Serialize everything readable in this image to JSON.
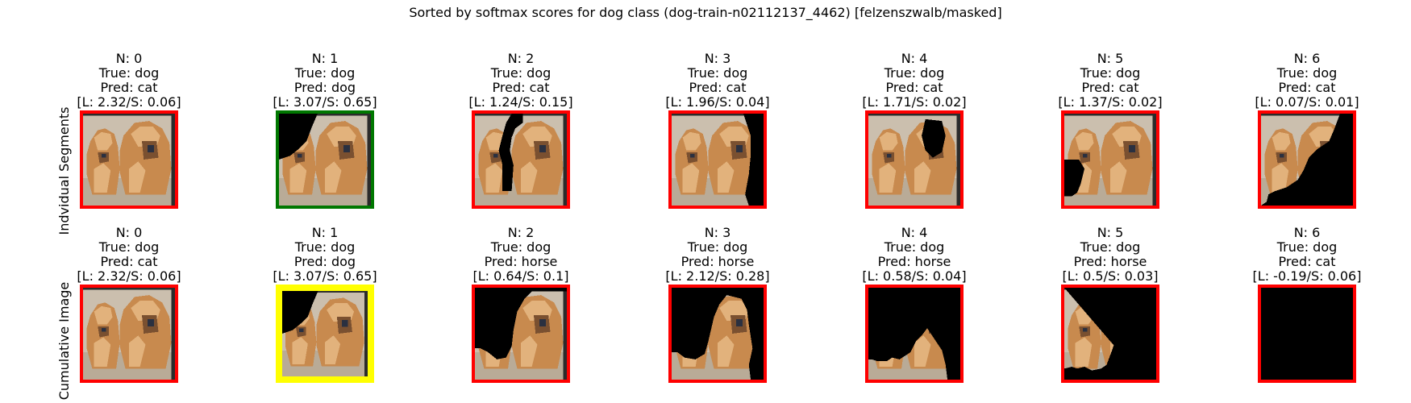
{
  "chart_data": {
    "type": "image_grid",
    "title": "Sorted by softmax scores for dog class (dog-train-n02112137_4462) [felzenszwalb/masked]",
    "rows": [
      {
        "label": "Indvidual Segments",
        "panels": [
          {
            "n": "N: 0",
            "true": "True: dog",
            "pred": "Pred: cat",
            "score": "[L: 2.32/S: 0.06]",
            "border": "#ff0000",
            "mask": "none"
          },
          {
            "n": "N: 1",
            "true": "True: dog",
            "pred": "Pred: dog",
            "score": "[L: 3.07/S: 0.65]",
            "border": "#007700",
            "mask": "bg-left"
          },
          {
            "n": "N: 2",
            "true": "True: dog",
            "pred": "Pred: cat",
            "score": "[L: 1.24/S: 0.15]",
            "border": "#ff0000",
            "mask": "left-dog-head"
          },
          {
            "n": "N: 3",
            "true": "True: dog",
            "pred": "Pred: cat",
            "score": "[L: 1.96/S: 0.04]",
            "border": "#ff0000",
            "mask": "right-edge"
          },
          {
            "n": "N: 4",
            "true": "True: dog",
            "pred": "Pred: cat",
            "score": "[L: 1.71/S: 0.02]",
            "border": "#ff0000",
            "mask": "right-dog-face"
          },
          {
            "n": "N: 5",
            "true": "True: dog",
            "pred": "Pred: cat",
            "score": "[L: 1.37/S: 0.02]",
            "border": "#ff0000",
            "mask": "left-bottom"
          },
          {
            "n": "N: 6",
            "true": "True: dog",
            "pred": "Pred: cat",
            "score": "[L: 0.07/S: 0.01]",
            "border": "#ff0000",
            "mask": "bottom-right"
          }
        ]
      },
      {
        "label": "Cumulative Image",
        "panels": [
          {
            "n": "N: 0",
            "true": "True: dog",
            "pred": "Pred: cat",
            "score": "[L: 2.32/S: 0.06]",
            "border": "#ff0000",
            "mask": "none"
          },
          {
            "n": "N: 1",
            "true": "True: dog",
            "pred": "Pred: dog",
            "score": "[L: 3.07/S: 0.65]",
            "border": "#ffff00",
            "mask": "bg-left"
          },
          {
            "n": "N: 2",
            "true": "True: dog",
            "pred": "Pred: horse",
            "score": "[L: 0.64/S: 0.1]",
            "border": "#ff0000",
            "mask": "cum-2"
          },
          {
            "n": "N: 3",
            "true": "True: dog",
            "pred": "Pred: horse",
            "score": "[L: 2.12/S: 0.28]",
            "border": "#ff0000",
            "mask": "cum-3"
          },
          {
            "n": "N: 4",
            "true": "True: dog",
            "pred": "Pred: horse",
            "score": "[L: 0.58/S: 0.04]",
            "border": "#ff0000",
            "mask": "cum-4"
          },
          {
            "n": "N: 5",
            "true": "True: dog",
            "pred": "Pred: horse",
            "score": "[L: 0.5/S: 0.03]",
            "border": "#ff0000",
            "mask": "cum-5"
          },
          {
            "n": "N: 6",
            "true": "True: dog",
            "pred": "Pred: cat",
            "score": "[L: -0.19/S: 0.06]",
            "border": "#ff0000",
            "mask": "all"
          }
        ]
      }
    ],
    "colors": {
      "background_wall": "#cbbfae",
      "floor": "#b9ab97",
      "dog_fur": "#c88a4e",
      "dog_fur_light": "#e2b27c",
      "dog_shadow": "#7a5030",
      "dog_nose": "#2a3040",
      "mask": "#000000"
    }
  }
}
